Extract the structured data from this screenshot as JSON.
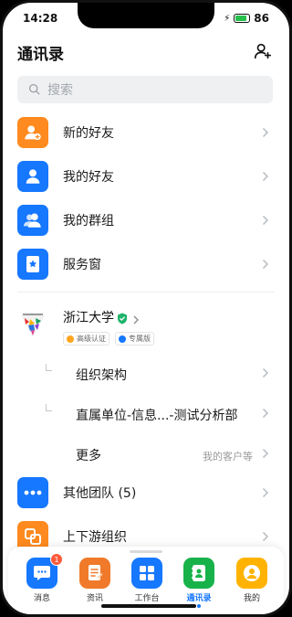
{
  "status": {
    "time": "14:28",
    "battery": "86",
    "battery_level": 0.86
  },
  "header": {
    "title": "通讯录"
  },
  "search": {
    "placeholder": "搜索"
  },
  "menu": [
    {
      "label": "新的好友",
      "icon": "new-friend-icon",
      "color": "#ff8a1f"
    },
    {
      "label": "我的好友",
      "icon": "friend-icon",
      "color": "#1677ff"
    },
    {
      "label": "我的群组",
      "icon": "group-icon",
      "color": "#1677ff"
    },
    {
      "label": "服务窗",
      "icon": "service-window-icon",
      "color": "#1677ff"
    }
  ],
  "org": {
    "name": "浙江大学",
    "badges": [
      "高级认证",
      "专属版"
    ],
    "sub_items": [
      {
        "label": "组织架构"
      },
      {
        "label": "直属单位-信息...-测试分析部"
      },
      {
        "label": "更多",
        "note": "我的客户等"
      }
    ]
  },
  "more": [
    {
      "label": "其他团队 (5)",
      "icon": "other-team-icon",
      "color": "#1677ff"
    },
    {
      "label": "上下游组织",
      "icon": "upstream-org-icon",
      "color": "#ff8a1f"
    }
  ],
  "tabs": [
    {
      "label": "消息",
      "icon": "message-icon",
      "color": "#1677ff",
      "badge": "1"
    },
    {
      "label": "资讯",
      "icon": "news-icon",
      "color": "#f07a2a"
    },
    {
      "label": "工作台",
      "icon": "workbench-icon",
      "color": "#1677ff"
    },
    {
      "label": "通讯录",
      "icon": "contacts-icon",
      "color": "#18b24b",
      "active": true
    },
    {
      "label": "我的",
      "icon": "profile-icon",
      "color": "#ffb300"
    }
  ]
}
